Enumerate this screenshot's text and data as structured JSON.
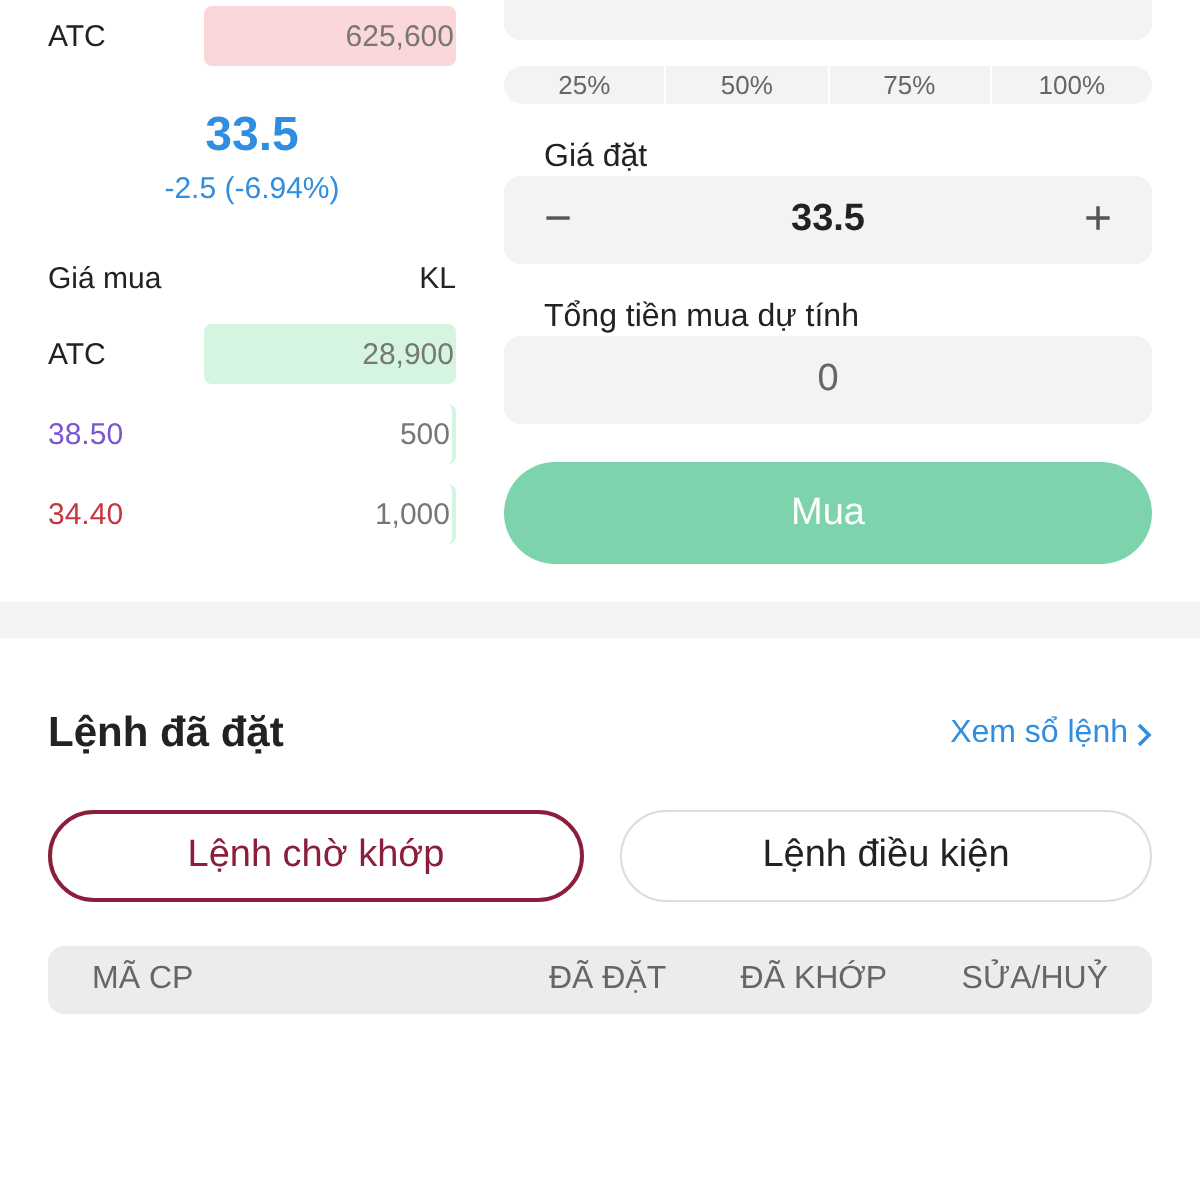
{
  "ask_rows": [
    {
      "price": "ATC",
      "volume": "625,600",
      "highlighted": true,
      "color": "#222222"
    }
  ],
  "last_price": {
    "price": "33.5",
    "change": "-2.5 (-6.94%)"
  },
  "bid_header": {
    "price": "Giá mua",
    "volume": "KL"
  },
  "bid_rows": [
    {
      "price": "ATC",
      "volume": "28,900",
      "highlighted": true,
      "color": "#222222"
    },
    {
      "price": "38.50",
      "volume": "500",
      "highlighted": false,
      "color": "#7b55d6"
    },
    {
      "price": "34.40",
      "volume": "1,000",
      "highlighted": false,
      "color": "#c6363f"
    }
  ],
  "percent_buttons": [
    "25%",
    "50%",
    "75%",
    "100%"
  ],
  "price_field": {
    "label": "Giá đặt",
    "value": "33.5",
    "minus": "−",
    "plus": "+"
  },
  "total_field": {
    "label": "Tổng tiền mua dự tính",
    "value": "0"
  },
  "buy_button": {
    "label": "Mua",
    "disabled": true
  },
  "orders": {
    "title": "Lệnh đã đặt",
    "link": "Xem sổ lệnh",
    "tabs": [
      {
        "label": "Lệnh chờ khớp",
        "selected": true
      },
      {
        "label": "Lệnh điều kiện",
        "selected": false
      }
    ],
    "columns": [
      "MÃ CP",
      "ĐÃ ĐẶT",
      "ĐÃ KHỚP",
      "SỬA/HUỶ"
    ]
  }
}
